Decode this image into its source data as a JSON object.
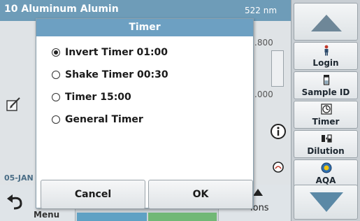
{
  "background": {
    "header_title": "10 Aluminum Alumin",
    "wavelength": "522 nm",
    "value_top": ".800",
    "value_bottom": ".000",
    "date": "05-JAN",
    "menu_label": "Menu",
    "options_label": "ions"
  },
  "dialog": {
    "title": "Timer",
    "options": [
      {
        "label": "Invert Timer 01:00",
        "selected": true
      },
      {
        "label": "Shake Timer 00:30",
        "selected": false
      },
      {
        "label": "Timer 15:00",
        "selected": false
      },
      {
        "label": "General Timer",
        "selected": false
      }
    ],
    "cancel_label": "Cancel",
    "ok_label": "OK"
  },
  "sidebar": {
    "buttons": [
      {
        "label": "Login",
        "icon": "person-icon"
      },
      {
        "label": "Sample ID",
        "icon": "vial-icon"
      },
      {
        "label": "Timer",
        "icon": "timer-icon"
      },
      {
        "label": "Dilution",
        "icon": "dilution-icon"
      },
      {
        "label": "AQA",
        "icon": "aqa-icon"
      }
    ]
  },
  "colors": {
    "header_blue": "#6e9cb8",
    "dialog_title_blue": "#6da0c2",
    "tab_blue": "#5fa1c4",
    "tab_green": "#71b876",
    "scroll_arrow": "#5b89a6"
  }
}
